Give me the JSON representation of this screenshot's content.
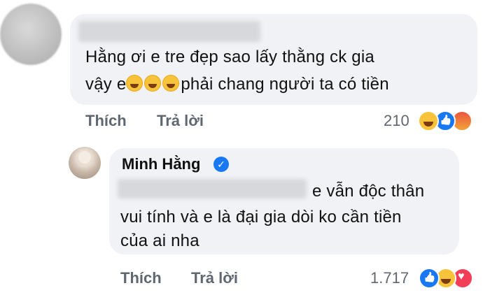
{
  "comment_1": {
    "text_line_1": "Hằng ơi e tre đẹp sao lấy thằng ck gia",
    "text_line_2_pre": "vậy e",
    "text_line_2_post": "phải chang người ta có tiền",
    "like_label": "Thích",
    "reply_label": "Trả lời",
    "reaction_count": "210",
    "reactions": [
      "haha",
      "like",
      "angry"
    ]
  },
  "comment_2": {
    "author_name": "Minh Hằng",
    "text_line_1": "e vẫn độc thân",
    "text_line_2": "vui tính và e là đại gia dòi ko cần tiền",
    "text_line_3": "của ai nha",
    "like_label": "Thích",
    "reply_label": "Trả lời",
    "reaction_count": "1.717",
    "reactions": [
      "like",
      "haha",
      "love"
    ]
  },
  "colors": {
    "bubble": "#f0f2f5",
    "action_text": "#606770",
    "verified": "#1877f2"
  }
}
